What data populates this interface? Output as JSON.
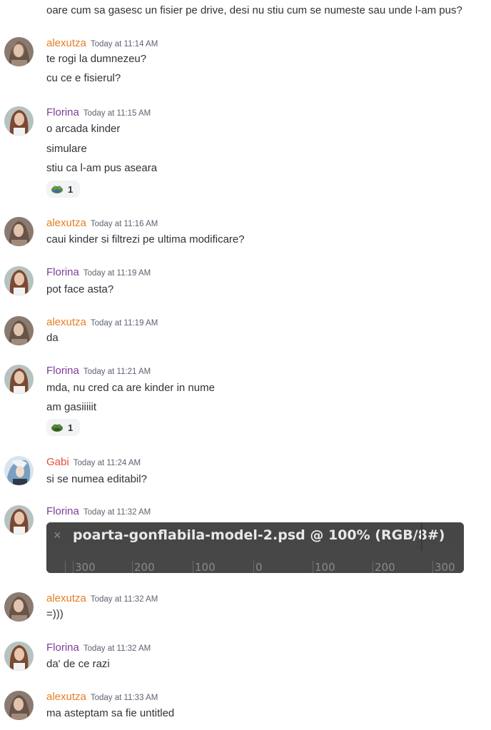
{
  "top_message": "oare cum sa gasesc un fisier pe drive, desi nu stiu cum se numeste sau unde l-am pus?",
  "messages": [
    {
      "author": "alexutza",
      "time": "Today at 11:14 AM",
      "lines": [
        "te rogi la dumnezeu?",
        "cu ce e fisierul?"
      ]
    },
    {
      "author": "Florina",
      "time": "Today at 11:15 AM",
      "lines": [
        "o arcada kinder",
        "simulare",
        "stiu ca l-am pus aseara"
      ],
      "reaction": {
        "emoji": "frog-icon",
        "count": "1"
      }
    },
    {
      "author": "alexutza",
      "time": "Today at 11:16 AM",
      "lines": [
        "caui kinder si filtrezi pe ultima modificare?"
      ]
    },
    {
      "author": "Florina",
      "time": "Today at 11:19 AM",
      "lines": [
        "pot face asta?"
      ]
    },
    {
      "author": "alexutza",
      "time": "Today at 11:19 AM",
      "lines": [
        "da"
      ]
    },
    {
      "author": "Florina",
      "time": "Today at 11:21 AM",
      "lines": [
        "mda, nu cred ca are kinder in nume",
        "am gasiiiiit"
      ],
      "reaction": {
        "emoji": "frog-icon",
        "count": "1"
      }
    },
    {
      "author": "Gabi",
      "time": "Today at 11:24 AM",
      "lines": [
        "si se numea editabil?"
      ]
    },
    {
      "author": "Florina",
      "time": "Today at 11:32 AM",
      "lines": []
    },
    {
      "author": "alexutza",
      "time": "Today at 11:32 AM",
      "lines": [
        "=)))"
      ]
    },
    {
      "author": "Florina",
      "time": "Today at 11:32 AM",
      "lines": [
        "da' de ce razi"
      ]
    },
    {
      "author": "alexutza",
      "time": "Today at 11:33 AM",
      "lines": [
        "ma asteptam sa fie untitled"
      ]
    }
  ],
  "attachment": {
    "close": "×",
    "title": "poarta-gonflabila-model-2.psd @ 100% (RGB/8#)",
    "ruler": [
      "300",
      "200",
      "100",
      "0",
      "100",
      "200",
      "300"
    ]
  },
  "colors": {
    "alexutza": "#e67e22",
    "Florina": "#7d3c98",
    "Gabi": "#e74c3c"
  }
}
